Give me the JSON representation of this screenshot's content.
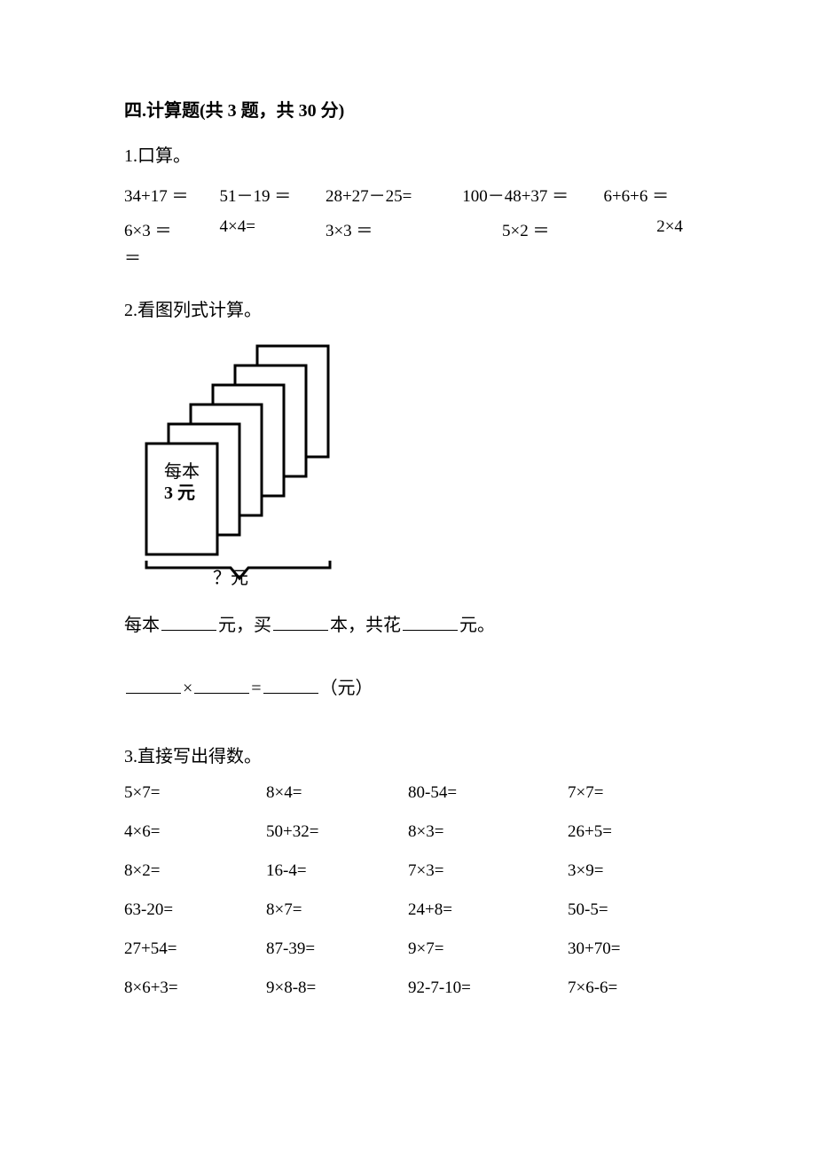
{
  "section": {
    "title": "四.计算题(共 3 题，共 30 分)"
  },
  "q1": {
    "label": "1.口算。",
    "row1": [
      "34+17 ＝",
      "51－19 ＝",
      "28+27－25=",
      "100－48+37 ＝",
      "6+6+6 ＝"
    ],
    "row2": [
      "6×3 ＝",
      "4×4=",
      "3×3 ＝",
      "5×2 ＝",
      "2×4"
    ],
    "row2_tail": "＝"
  },
  "q2": {
    "label": "2.看图列式计算。",
    "figure": {
      "per_label1": "每本",
      "per_label2": "3 元",
      "bottom_label": "？元"
    },
    "fill": {
      "prefix": "每本",
      "mid1": "元，买",
      "mid2": "本，共花",
      "suffix": "元。"
    },
    "equation": {
      "op": "×",
      "eq": "=",
      "unit": "（元）"
    }
  },
  "q3": {
    "label": "3.直接写出得数。",
    "rows": [
      [
        "5×7=",
        "8×4=",
        "80-54=",
        "7×7="
      ],
      [
        "4×6=",
        "50+32=",
        "8×3=",
        "26+5="
      ],
      [
        "8×2=",
        "16-4=",
        "7×3=",
        "3×9="
      ],
      [
        "63-20=",
        "8×7=",
        "24+8=",
        "50-5="
      ],
      [
        "27+54=",
        "87-39=",
        "9×7=",
        "30+70="
      ],
      [
        "8×6+3=",
        "9×8-8=",
        "92-7-10=",
        "7×6-6="
      ]
    ]
  }
}
